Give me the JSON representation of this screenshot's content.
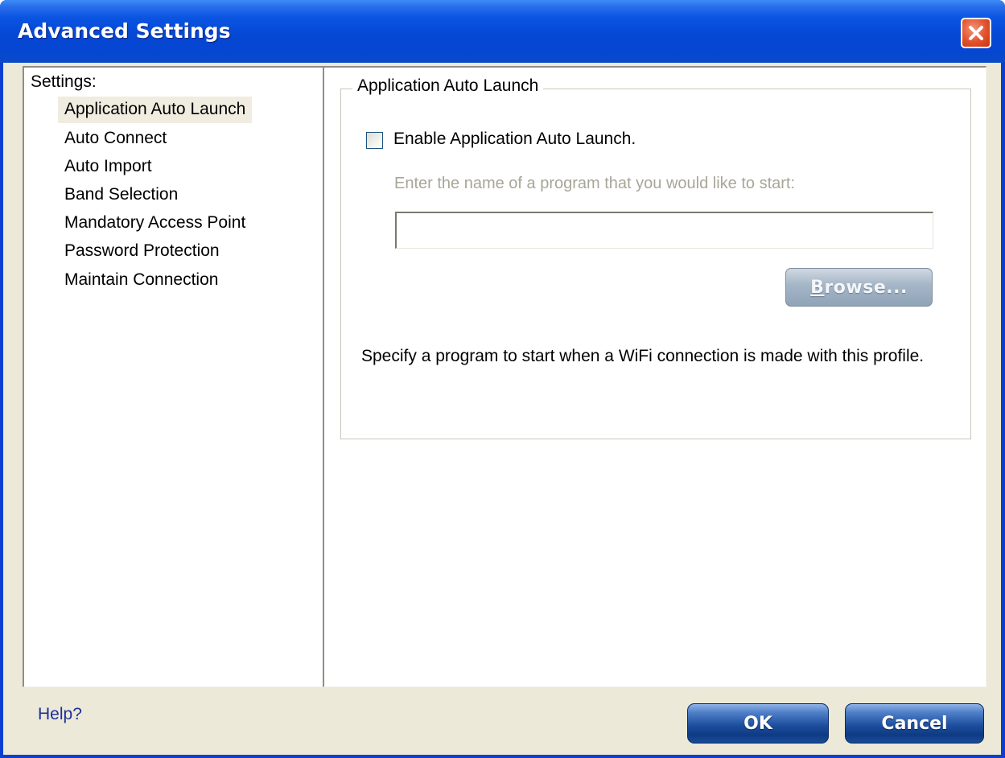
{
  "window": {
    "title": "Advanced Settings",
    "close_icon": "close-icon"
  },
  "nav": {
    "header": "Settings:",
    "selected": "Application Auto Launch",
    "items": [
      "Application Auto Launch",
      "Auto Connect",
      "Auto Import",
      "Band Selection",
      "Mandatory Access Point",
      "Password Protection",
      "Maintain Connection"
    ]
  },
  "content": {
    "group_title": "Application Auto Launch",
    "checkbox_label": "Enable Application Auto Launch.",
    "checkbox_checked": false,
    "prompt": "Enter the name of a program that you would like to start:",
    "program_value": "",
    "browse_pre": "B",
    "browse_rest": "rowse...",
    "description": "Specify a program to start when a WiFi connection is made with this profile."
  },
  "footer": {
    "help": "Help?",
    "ok": "OK",
    "cancel": "Cancel"
  },
  "colors": {
    "titlebar": "#0548d4",
    "dialog_face": "#ece9d8",
    "close_button": "#e2502c",
    "primary_button": "#1d4f9e",
    "disabled_button": "#a4b5c6",
    "help_link": "#1d2f9b"
  }
}
